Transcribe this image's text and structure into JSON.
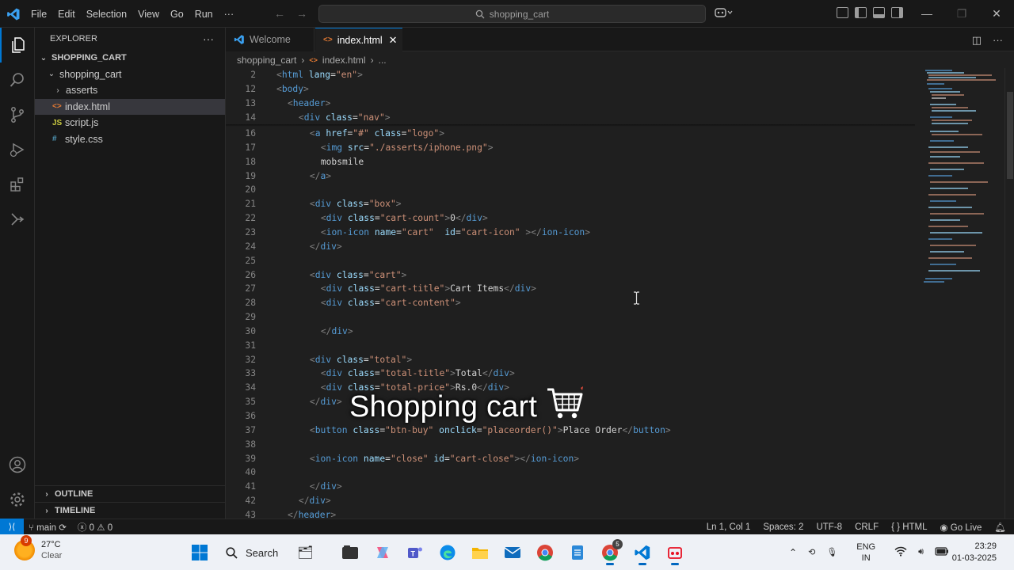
{
  "titlebar": {
    "menu": [
      "File",
      "Edit",
      "Selection",
      "View",
      "Go",
      "Run",
      "···"
    ],
    "search_text": "shopping_cart"
  },
  "sidebar": {
    "title": "EXPLORER",
    "more": "···",
    "workspace": "SHOPPING_CART",
    "folder": "shopping_cart",
    "items": [
      {
        "label": "asserts",
        "type": "folder"
      },
      {
        "label": "index.html",
        "type": "html"
      },
      {
        "label": "script.js",
        "type": "js"
      },
      {
        "label": "style.css",
        "type": "css"
      }
    ],
    "outline": "OUTLINE",
    "timeline": "TIMELINE"
  },
  "tabs": [
    {
      "label": "Welcome"
    },
    {
      "label": "index.html"
    }
  ],
  "breadcrumb": [
    "shopping_cart",
    "index.html",
    "..."
  ],
  "editor": {
    "sticky": [
      {
        "n": "2",
        "code": "<html lang=\"en\">",
        "indent": 0
      },
      {
        "n": "12",
        "code": "<body>",
        "indent": 0
      },
      {
        "n": "13",
        "code": "<header>",
        "indent": 2
      },
      {
        "n": "14",
        "code": "<div class=\"nav\">",
        "indent": 4
      }
    ],
    "lines": [
      {
        "n": "16",
        "indent": 6,
        "code": "<a href=\"#\" class=\"logo\">"
      },
      {
        "n": "17",
        "indent": 8,
        "code": "<img src=\"./asserts/iphone.png\">"
      },
      {
        "n": "18",
        "indent": 8,
        "code": "mobsmile"
      },
      {
        "n": "19",
        "indent": 6,
        "code": "</a>"
      },
      {
        "n": "20",
        "indent": 0,
        "code": ""
      },
      {
        "n": "21",
        "indent": 6,
        "code": "<div class=\"box\">"
      },
      {
        "n": "22",
        "indent": 8,
        "code": "<div class=\"cart-count\">0</div>"
      },
      {
        "n": "23",
        "indent": 8,
        "code": "<ion-icon name=\"cart\"  id=\"cart-icon\" ></ion-icon>"
      },
      {
        "n": "24",
        "indent": 6,
        "code": "</div>"
      },
      {
        "n": "25",
        "indent": 0,
        "code": ""
      },
      {
        "n": "26",
        "indent": 6,
        "code": "<div class=\"cart\">"
      },
      {
        "n": "27",
        "indent": 8,
        "code": "<div class=\"cart-title\">Cart Items</div>"
      },
      {
        "n": "28",
        "indent": 8,
        "code": "<div class=\"cart-content\">"
      },
      {
        "n": "29",
        "indent": 0,
        "code": ""
      },
      {
        "n": "30",
        "indent": 8,
        "code": "</div>"
      },
      {
        "n": "31",
        "indent": 0,
        "code": ""
      },
      {
        "n": "32",
        "indent": 6,
        "code": "<div class=\"total\">"
      },
      {
        "n": "33",
        "indent": 8,
        "code": "<div class=\"total-title\">Total</div>"
      },
      {
        "n": "34",
        "indent": 8,
        "code": "<div class=\"total-price\">Rs.0</div>"
      },
      {
        "n": "35",
        "indent": 6,
        "code": "</div>"
      },
      {
        "n": "36",
        "indent": 0,
        "code": ""
      },
      {
        "n": "37",
        "indent": 6,
        "code": "<button class=\"btn-buy\" onclick=\"placeorder()\">Place Order</button>"
      },
      {
        "n": "38",
        "indent": 0,
        "code": ""
      },
      {
        "n": "39",
        "indent": 6,
        "code": "<ion-icon name=\"close\" id=\"cart-close\"></ion-icon>"
      },
      {
        "n": "40",
        "indent": 0,
        "code": ""
      },
      {
        "n": "41",
        "indent": 6,
        "code": "</div>"
      },
      {
        "n": "42",
        "indent": 4,
        "code": "</div>"
      },
      {
        "n": "43",
        "indent": 2,
        "code": "</header>"
      }
    ],
    "overlay_caption": "Shopping cart"
  },
  "statusbar": {
    "branch": "main",
    "errors": "0",
    "warnings": "0",
    "position": "Ln 1, Col 1",
    "spaces": "Spaces: 2",
    "encoding": "UTF-8",
    "eol": "CRLF",
    "language": "HTML",
    "golive": "Go Live"
  },
  "taskbar": {
    "weather_badge": "9",
    "temperature": "27°C",
    "condition": "Clear",
    "search_label": "Search",
    "chrome_badge": "5",
    "language": "ENG",
    "region": "IN",
    "time": "23:29",
    "date": "01-03-2025"
  },
  "colors": {
    "accent": "#0078d4",
    "editor_bg": "#1f1f1f",
    "tag": "#569cd6",
    "attr": "#9cdcfe",
    "string": "#ce9178"
  }
}
